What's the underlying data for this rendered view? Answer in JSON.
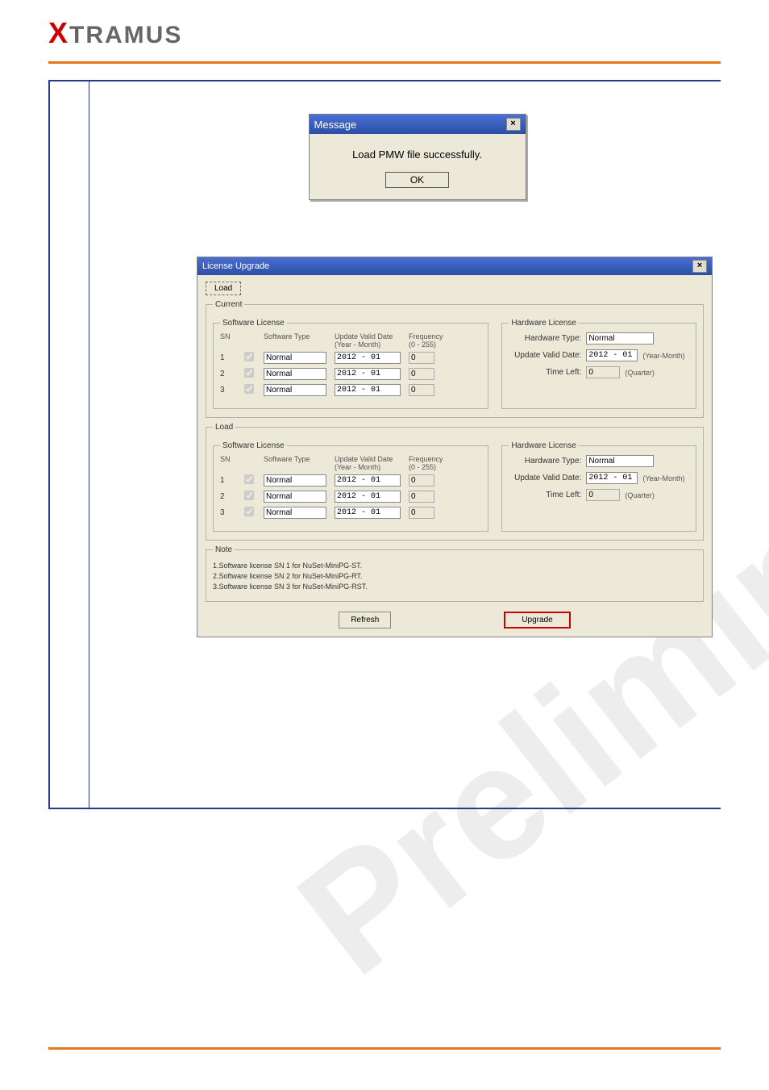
{
  "brand": {
    "prefix": "X",
    "rest": "TRAMUS"
  },
  "msg": {
    "title": "Message",
    "text": "Load PMW file successfully.",
    "ok": "OK",
    "close": "×"
  },
  "lic": {
    "title": "License Upgrade",
    "close": "×",
    "load_btn": "Load",
    "sections": {
      "current": "Current",
      "load": "Load",
      "software": "Software License",
      "hardware": "Hardware License",
      "note": "Note"
    },
    "sw_columns": {
      "sn": "SN",
      "type": "Software Type",
      "date": "Update Valid Date\n(Year - Month)",
      "freq": "Frequency\n(0 - 255)"
    },
    "current_sw": [
      {
        "sn": "1",
        "checked": true,
        "type": "Normal",
        "date": "2012 - 01",
        "freq": "0"
      },
      {
        "sn": "2",
        "checked": true,
        "type": "Normal",
        "date": "2012 - 01",
        "freq": "0"
      },
      {
        "sn": "3",
        "checked": true,
        "type": "Normal",
        "date": "2012 - 01",
        "freq": "0"
      }
    ],
    "current_hw": {
      "hardware_type_lbl": "Hardware Type:",
      "hardware_type_val": "Normal",
      "update_valid_lbl": "Update Valid Date:",
      "update_valid_val": "2012 - 01",
      "update_valid_suffix": "(Year-Month)",
      "time_left_lbl": "Time Left:",
      "time_left_val": "0",
      "time_left_suffix": "(Quarter)"
    },
    "load_sw": [
      {
        "sn": "1",
        "checked": true,
        "type": "Normal",
        "date": "2012 - 01",
        "freq": "0"
      },
      {
        "sn": "2",
        "checked": true,
        "type": "Normal",
        "date": "2012 - 01",
        "freq": "0"
      },
      {
        "sn": "3",
        "checked": true,
        "type": "Normal",
        "date": "2012 - 01",
        "freq": "0"
      }
    ],
    "load_hw": {
      "hardware_type_lbl": "Hardware Type:",
      "hardware_type_val": "Normal",
      "update_valid_lbl": "Update Valid Date:",
      "update_valid_val": "2012 - 01",
      "update_valid_suffix": "(Year-Month)",
      "time_left_lbl": "Time Left:",
      "time_left_val": "0",
      "time_left_suffix": "(Quarter)"
    },
    "notes": [
      "1.Software license SN 1 for NuSet-MiniPG-ST.",
      "2.Software license SN 2 for NuSet-MiniPG-RT.",
      "3.Software license SN 3 for NuSet-MiniPG-RST."
    ],
    "buttons": {
      "refresh": "Refresh",
      "upgrade": "Upgrade"
    }
  },
  "watermark": "Preliminary"
}
